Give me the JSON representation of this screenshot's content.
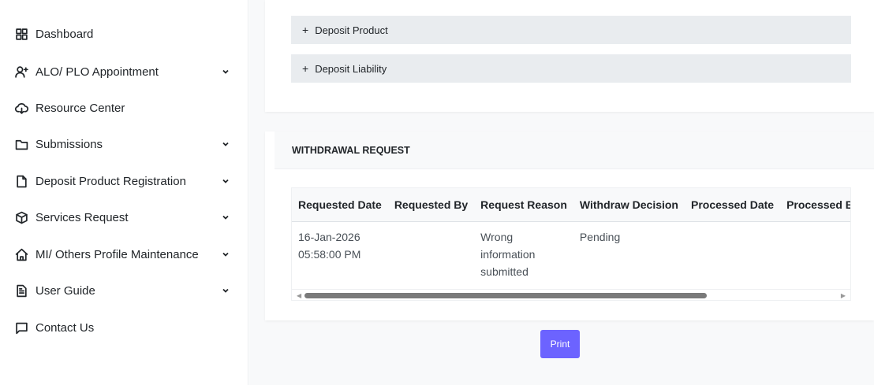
{
  "sidebar": {
    "items": [
      {
        "label": "Dashboard",
        "icon": "grid-icon",
        "has_chevron": false
      },
      {
        "label": "ALO/ PLO Appointment",
        "icon": "user-plus-icon",
        "has_chevron": true
      },
      {
        "label": "Resource Center",
        "icon": "cloud-download-icon",
        "has_chevron": false
      },
      {
        "label": "Submissions",
        "icon": "folder-icon",
        "has_chevron": true
      },
      {
        "label": "Deposit Product Registration",
        "icon": "file-icon",
        "has_chevron": true
      },
      {
        "label": "Services Request",
        "icon": "box-icon",
        "has_chevron": true
      },
      {
        "label": "MI/ Others Profile Maintenance",
        "icon": "home-icon",
        "has_chevron": true
      },
      {
        "label": "User Guide",
        "icon": "document-text-icon",
        "has_chevron": true
      },
      {
        "label": "Contact Us",
        "icon": "chat-icon",
        "has_chevron": false
      }
    ]
  },
  "accordions": [
    {
      "label": "Deposit Product",
      "symbol": "+"
    },
    {
      "label": "Deposit Liability",
      "symbol": "+"
    }
  ],
  "withdrawal": {
    "title": "WITHDRAWAL REQUEST",
    "columns": [
      "Requested Date",
      "Requested By",
      "Request Reason",
      "Withdraw Decision",
      "Processed Date",
      "Processed By"
    ],
    "rows": [
      {
        "requested_date": "16-Jan-2026",
        "requested_time": "05:58:00 PM",
        "requested_by": "",
        "reason_line1": "Wrong",
        "reason_line2": "information",
        "reason_line3": "submitted",
        "decision": "Pending",
        "processed_date": "",
        "processed_by": ""
      }
    ]
  },
  "actions": {
    "print_label": "Print"
  },
  "colors": {
    "primary_button": "#6c63ff",
    "accordion_bg": "#e9ecef",
    "page_bg": "#f8f9fa"
  }
}
